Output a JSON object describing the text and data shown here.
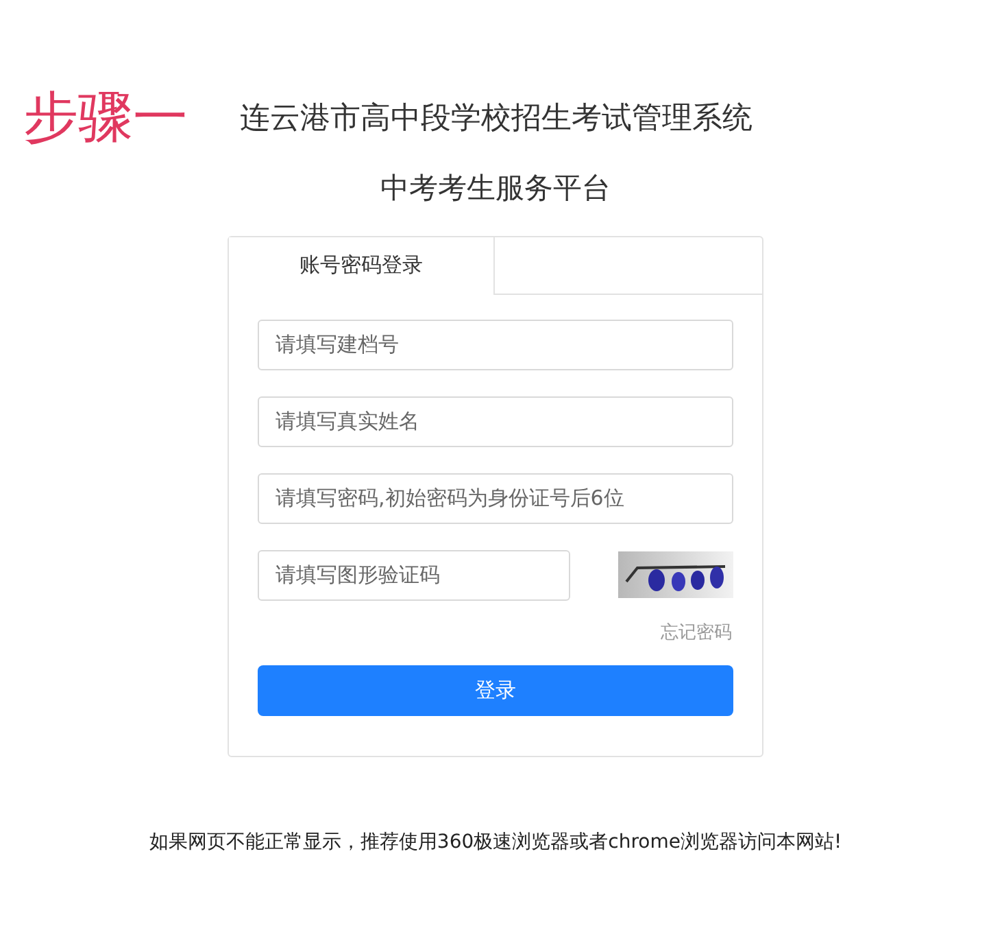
{
  "annotation": {
    "text": "步骤一"
  },
  "header": {
    "title": "连云港市高中段学校招生考试管理系统",
    "subtitle": "中考考生服务平台"
  },
  "tabs": [
    {
      "label": "账号密码登录",
      "selected": true
    }
  ],
  "fields": [
    {
      "kind": "text",
      "placeholder": "请填写建档号"
    },
    {
      "kind": "text",
      "placeholder": "请填写真实姓名"
    },
    {
      "kind": "password",
      "placeholder": "请填写密码,初始密码为身份证号后6位"
    },
    {
      "kind": "captcha",
      "placeholder": "请填写图形验证码"
    }
  ],
  "forgot_link": "忘记密码",
  "login_button": "登录",
  "footer_note": "如果网页不能正常显示，推荐使用360极速浏览器或者chrome浏览器访问本网站!"
}
